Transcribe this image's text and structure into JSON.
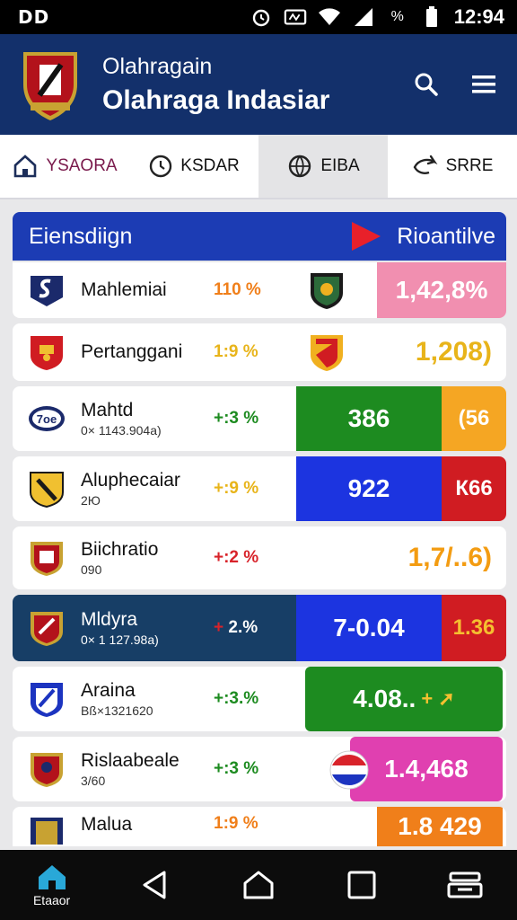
{
  "status_bar": {
    "left_text": "DD",
    "time": "12:94",
    "battery_text": "%"
  },
  "app_bar": {
    "subtitle": "Olahragain",
    "title": "Olahraga Indasiar"
  },
  "tabs": [
    {
      "label": "YSAORA",
      "icon": "home-icon"
    },
    {
      "label": "KSDAR",
      "icon": "clock-icon"
    },
    {
      "label": "EIBA",
      "icon": "ball-icon"
    },
    {
      "label": "SRRE",
      "icon": "share-icon"
    }
  ],
  "list_header": {
    "left": "Eiensdiign",
    "right": "Rioantilve"
  },
  "rows": [
    {
      "name": "Mahlemiai",
      "sub": "",
      "change": "110 %",
      "value": "1,42,8%",
      "side": ""
    },
    {
      "name": "Pertanggani",
      "sub": "",
      "change": "1:9 %",
      "value": "1,208)",
      "side": ""
    },
    {
      "name": "Mahtd",
      "sub": "0× 1143.904a)",
      "change": "+:3 %",
      "value": "386",
      "side": "(56"
    },
    {
      "name": "Aluphecaiar",
      "sub": "2Ю",
      "change": "+:9 %",
      "value": "922",
      "side": "К66"
    },
    {
      "name": "Biichratio",
      "sub": "090",
      "change": "+:2 %",
      "value": "1,7/..6)",
      "side": ""
    },
    {
      "name": "Mldyra",
      "sub": "0× 1 127.98a)",
      "change": "2.%",
      "value": "7-0.04",
      "side": "1.36"
    },
    {
      "name": "Araina",
      "sub": "Bß×1321620",
      "change": "+:3.%",
      "value": "4.08..",
      "side": ""
    },
    {
      "name": "Rislaabeale",
      "sub": "3/60",
      "change": "+:3 %",
      "value": "1.4,468",
      "side": ""
    },
    {
      "name": "Malua",
      "sub": "",
      "change": "1:9 %",
      "value": "1.8 429",
      "side": ""
    }
  ],
  "nav": {
    "home_label": "Etaaor"
  },
  "colors": {
    "primary": "#13306b",
    "header_blue": "#1c3cb4",
    "green": "#1d8b20",
    "red": "#d8232a",
    "orange": "#f39c12"
  }
}
